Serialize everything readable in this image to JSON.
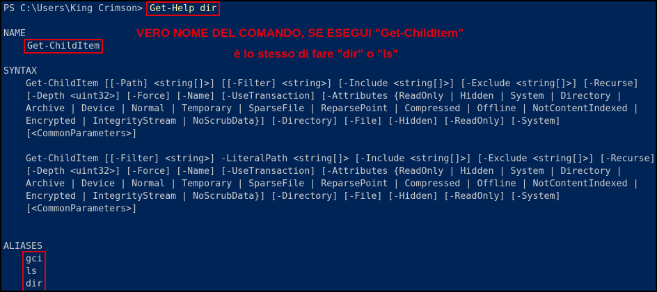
{
  "prompt": {
    "text": "PS C:\\Users\\King Crimson>",
    "command": "Get-Help dir"
  },
  "annotation": {
    "line1": "VERO NOME DEL COMANDO, SE ESEGUI \"Get-ChildItem\"",
    "line2": "è lo stesso di fare \"dir\" o \"ls\""
  },
  "sections": {
    "name_header": "NAME",
    "name_value": "Get-ChildItem",
    "syntax_header": "SYNTAX",
    "syntax1": [
      "Get-ChildItem [[-Path] <string[]>] [[-Filter] <string>] [-Include <string[]>] [-Exclude <string[]>] [-Recurse]",
      "[-Depth <uint32>] [-Force] [-Name] [-UseTransaction] [-Attributes {ReadOnly | Hidden | System | Directory |",
      "Archive | Device | Normal | Temporary | SparseFile | ReparsePoint | Compressed | Offline | NotContentIndexed |",
      "Encrypted | IntegrityStream | NoScrubData}] [-Directory] [-File] [-Hidden] [-ReadOnly] [-System]",
      "[<CommonParameters>]"
    ],
    "syntax2": [
      "Get-ChildItem [[-Filter] <string>] -LiteralPath <string[]> [-Include <string[]>] [-Exclude <string[]>] [-Recurse]",
      "[-Depth <uint32>] [-Force] [-Name] [-UseTransaction] [-Attributes {ReadOnly | Hidden | System | Directory |",
      "Archive | Device | Normal | Temporary | SparseFile | ReparsePoint | Compressed | Offline | NotContentIndexed |",
      "Encrypted | IntegrityStream | NoScrubData}] [-Directory] [-File] [-Hidden] [-ReadOnly] [-System]",
      "[<CommonParameters>]"
    ],
    "aliases_header": "ALIASES",
    "aliases": [
      "gci",
      "ls",
      "dir"
    ]
  }
}
